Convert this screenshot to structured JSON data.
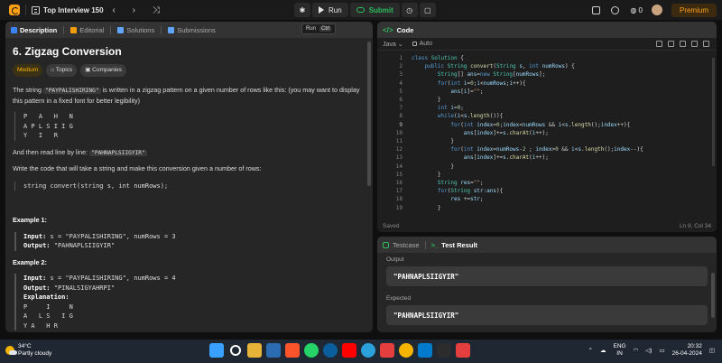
{
  "topbar": {
    "title": "Top Interview 150",
    "nav_arrows": "‹ › ⤨",
    "run_label": "Run",
    "submit_label": "Submit",
    "streak": "0",
    "premium_label": "Premium"
  },
  "left_tabs": [
    {
      "label": "Description",
      "icon": "description-icon",
      "color": "#3b82f6"
    },
    {
      "label": "Editorial",
      "icon": "editorial-icon",
      "color": "#f59e0b"
    },
    {
      "label": "Solutions",
      "icon": "flask-icon",
      "color": "#60a5fa"
    },
    {
      "label": "Submissions",
      "icon": "history-icon",
      "color": "#60a5fa"
    }
  ],
  "run_chip": {
    "label": "Run",
    "kbd": "Ctrl"
  },
  "problem": {
    "title": "6. Zigzag Conversion",
    "difficulty": "Medium",
    "topics": "Topics",
    "companies": "Companies",
    "intro_1": "The string ",
    "intro_code": "\"PAYPALISHIRING\"",
    "intro_2": " is written in a zigzag pattern on a given number of rows like this: (you may want to display this pattern in a fixed font for better legibility)",
    "zigzag": "P   A   H   N\nA P L S I I G\nY   I   R",
    "readline_1": "And then read line by line: ",
    "readline_code": "\"PAHNAPLSIIGYIR\"",
    "write_text": "Write the code that will take a string and make this conversion given a number of rows:",
    "signature": "string convert(string s, int numRows);",
    "example1_title": "Example 1:",
    "example1_input_label": "Input:",
    "example1_input": " s = \"PAYPALISHIRING\", numRows = 3",
    "example1_output_label": "Output:",
    "example1_output": " \"PAHNAPLSIIGYIR\"",
    "example2_title": "Example 2:",
    "example2_input_label": "Input:",
    "example2_input": " s = \"PAYPALISHIRING\", numRows = 4",
    "example2_output_label": "Output:",
    "example2_output": " \"PINALSIGYAHRPI\"",
    "example2_expl_label": "Explanation:",
    "example2_expl": "P     I     N\nA   L S   I G\nY A   H R"
  },
  "code": {
    "header": "Code",
    "language": "Java",
    "mode": "Auto",
    "saved": "Saved",
    "position": "Ln 9, Col 34",
    "line_numbers": [
      "1",
      "2",
      "3",
      "4",
      "5",
      "6",
      "7",
      "8",
      "9",
      "10",
      "11",
      "12",
      "13",
      "14",
      "15",
      "16",
      "17",
      "18",
      "19"
    ]
  },
  "result": {
    "tab_testcase": "Testcase",
    "tab_result": "Test Result",
    "output_label": "Output",
    "output_value": "\"PAHNAPLSIIGYIR\"",
    "expected_label": "Expected",
    "expected_value": "\"PAHNAPLSIIGYIR\""
  },
  "taskbar": {
    "temp": "34°C",
    "weather": "Partly cloudy",
    "lang_1": "ENG",
    "lang_2": "IN",
    "time": "20:32",
    "date": "26-04-2024"
  }
}
